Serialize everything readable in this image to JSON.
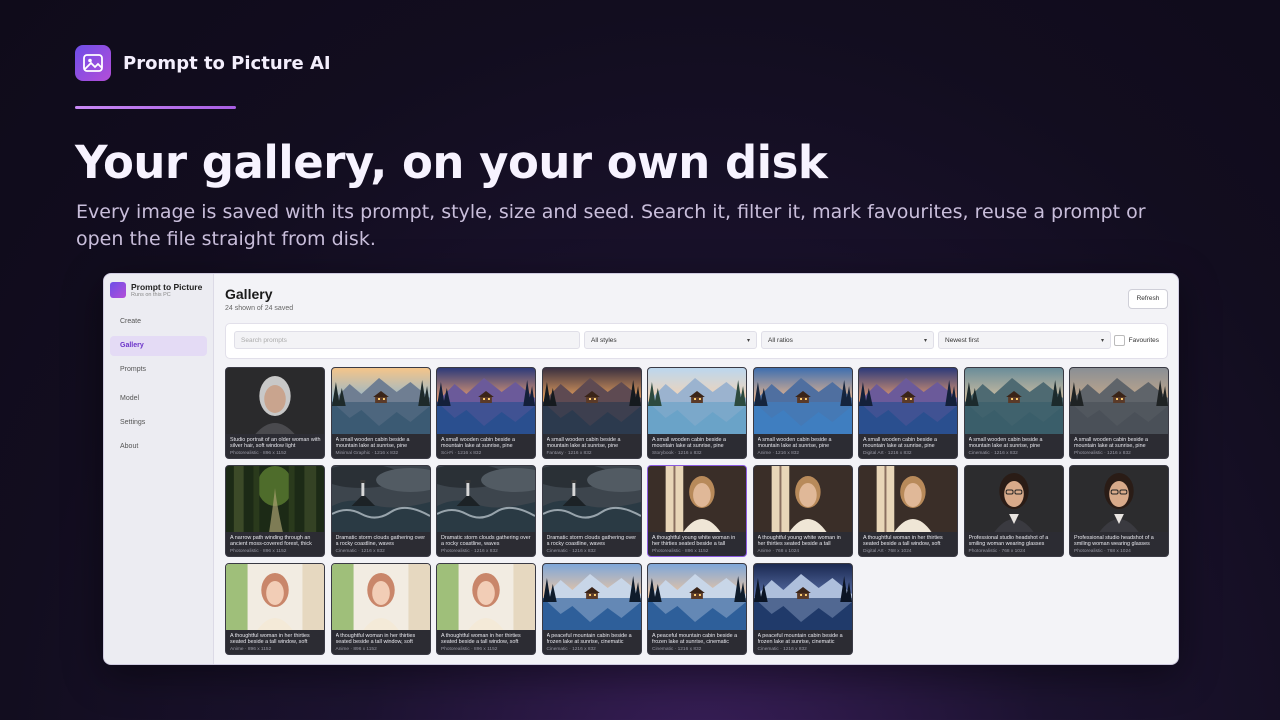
{
  "brand": {
    "name": "Prompt to Picture AI",
    "logo_icon": "image-icon"
  },
  "hero": {
    "title": "Your gallery, on your own disk",
    "subtitle": "Every image is saved with its prompt, style, size and seed. Search it, filter it, mark favourites, reuse a prompt or open the file straight from disk."
  },
  "app": {
    "title": "Prompt to Picture",
    "caption": "Runs on this PC",
    "nav": [
      {
        "label": "Create",
        "active": false
      },
      {
        "label": "Gallery",
        "active": true
      },
      {
        "label": "Prompts",
        "active": false
      },
      {
        "label": "Model",
        "active": false
      },
      {
        "label": "Settings",
        "active": false
      },
      {
        "label": "About",
        "active": false
      }
    ]
  },
  "gallery": {
    "title": "Gallery",
    "count": "24 shown of 24 saved",
    "refresh_label": "Refresh",
    "search_placeholder": "Search prompts",
    "style_filter": "All styles",
    "ratio_filter": "All ratios",
    "sort": "Newest first",
    "favourites_label": "Favourites",
    "items": [
      {
        "caption": "Studio portrait of an older woman with silver hair, soft window light",
        "meta": "Photorealistic · 896 x 1152",
        "kind": "portrait_old"
      },
      {
        "caption": "A small wooden cabin beside a mountain lake at sunrise, pine",
        "meta": "Minimal Graphic · 1216 x 832",
        "kind": "mountain_warm"
      },
      {
        "caption": "A small wooden cabin beside a mountain lake at sunrise, pine",
        "meta": "Sci-Fi · 1216 x 832",
        "kind": "mountain_purple"
      },
      {
        "caption": "A small wooden cabin beside a mountain lake at sunrise, pine",
        "meta": "Fantasy · 1216 x 832",
        "kind": "mountain_gold"
      },
      {
        "caption": "A small wooden cabin beside a mountain lake at sunrise, pine",
        "meta": "Storybook · 1216 x 832",
        "kind": "mountain_pastel"
      },
      {
        "caption": "A small wooden cabin beside a mountain lake at sunrise, pine",
        "meta": "Anime · 1216 x 832",
        "kind": "mountain_blue"
      },
      {
        "caption": "A small wooden cabin beside a mountain lake at sunrise, pine",
        "meta": "Digital Art · 1216 x 832",
        "kind": "mountain_purple"
      },
      {
        "caption": "A small wooden cabin beside a mountain lake at sunrise, pine",
        "meta": "Cinematic · 1216 x 832",
        "kind": "mountain_teal"
      },
      {
        "caption": "A small wooden cabin beside a mountain lake at sunrise, pine",
        "meta": "Photorealistic · 1216 x 832",
        "kind": "mountain_grey"
      },
      {
        "caption": "A narrow path winding through an ancient moss-covered forest, thick",
        "meta": "Photorealistic · 896 x 1152",
        "kind": "forest"
      },
      {
        "caption": "Dramatic storm clouds gathering over a rocky coastline, waves",
        "meta": "Cinematic · 1216 x 832",
        "kind": "storm"
      },
      {
        "caption": "Dramatic storm clouds gathering over a rocky coastline, waves",
        "meta": "Photorealistic · 1216 x 832",
        "kind": "storm"
      },
      {
        "caption": "Dramatic storm clouds gathering over a rocky coastline, waves",
        "meta": "Cinematic · 1216 x 832",
        "kind": "storm"
      },
      {
        "caption": "A thoughtful young white woman in her thirties seated beside a tall",
        "meta": "Photorealistic · 896 x 1152",
        "kind": "woman_window",
        "selected": true
      },
      {
        "caption": "A thoughtful young white woman in her thirties seated beside a tall",
        "meta": "Anime · 768 x 1024",
        "kind": "woman_window"
      },
      {
        "caption": "A thoughtful woman in her thirties seated beside a tall window, soft",
        "meta": "Digital Art · 768 x 1024",
        "kind": "woman_window"
      },
      {
        "caption": "Professional studio headshot of a smiling woman wearing glasses",
        "meta": "Photorealistic · 768 x 1024",
        "kind": "headshot"
      },
      {
        "caption": "Professional studio headshot of a smiling woman wearing glasses",
        "meta": "Photorealistic · 768 x 1024",
        "kind": "headshot"
      },
      {
        "caption": "A thoughtful woman in her thirties seated beside a tall window, soft",
        "meta": "Anime · 896 x 1152",
        "kind": "woman_anime"
      },
      {
        "caption": "A thoughtful woman in her thirties seated beside a tall window, soft",
        "meta": "Anime · 896 x 1152",
        "kind": "woman_anime"
      },
      {
        "caption": "A thoughtful woman in her thirties seated beside a tall window, soft",
        "meta": "Photorealistic · 896 x 1152",
        "kind": "woman_anime"
      },
      {
        "caption": "A peaceful mountain cabin beside a frozen lake at sunrise, cinematic",
        "meta": "Cinematic · 1216 x 832",
        "kind": "winter"
      },
      {
        "caption": "A peaceful mountain cabin beside a frozen lake at sunrise, cinematic",
        "meta": "Cinematic · 1216 x 832",
        "kind": "winter"
      },
      {
        "caption": "A peaceful mountain cabin beside a frozen lake at sunrise, cinematic",
        "meta": "Cinematic · 1216 x 832",
        "kind": "winter_night"
      }
    ]
  }
}
